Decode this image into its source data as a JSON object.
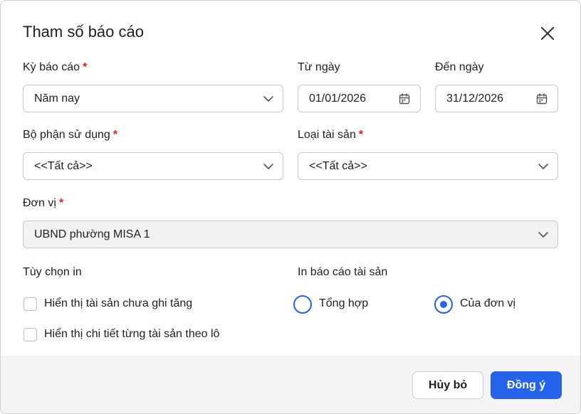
{
  "dialog": {
    "title": "Tham số báo cáo",
    "close_icon": "close-icon"
  },
  "fields": {
    "report_period": {
      "label": "Kỳ báo cáo",
      "required": "*",
      "value": "Năm nay"
    },
    "from_date": {
      "label": "Từ ngày",
      "value": "01/01/2026"
    },
    "to_date": {
      "label": "Đến ngày",
      "value": "31/12/2026"
    },
    "department": {
      "label": "Bộ phận sử dụng",
      "required": "*",
      "value": "<<Tất cả>>"
    },
    "asset_type": {
      "label": "Loại tài sản",
      "required": "*",
      "value": "<<Tất cả>>"
    },
    "unit": {
      "label": "Đơn vị",
      "required": "*",
      "value": "UBND phường MISA 1"
    }
  },
  "print_options": {
    "label": "Tùy chọn in",
    "items": [
      {
        "label": "Hiển thị tài sản chưa ghi tăng",
        "checked": false
      },
      {
        "label": "Hiển thị chi tiết từng tài sản theo lô",
        "checked": false
      }
    ]
  },
  "print_assets": {
    "label": "In báo cáo tài sản",
    "options": [
      {
        "label": "Tổng hợp",
        "selected": false
      },
      {
        "label": "Của đơn vị",
        "selected": true
      }
    ]
  },
  "footer": {
    "cancel_label": "Hủy bỏ",
    "ok_label": "Đồng ý"
  },
  "colors": {
    "accent": "#2563eb",
    "required": "#e0201a",
    "footer_bg": "#f4f4f5"
  }
}
